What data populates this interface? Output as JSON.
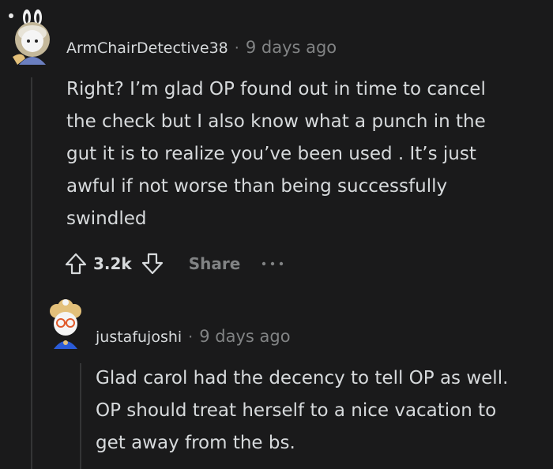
{
  "comments": [
    {
      "username": "ArmChairDetective38",
      "separator": "·",
      "timestamp": "9 days ago",
      "body_lines": [
        "Right? I’m glad OP found out in time to cancel",
        "the check but I also know what a punch in the",
        "gut it is to realize you’ve been used . It’s just",
        "awful if not worse than being successfully",
        "swindled"
      ],
      "actions": {
        "score": "3.2k",
        "share_label": "Share"
      }
    },
    {
      "username": "justafujoshi",
      "separator": "·",
      "timestamp": "9 days ago",
      "body_lines": [
        "Glad carol had the decency to tell OP as well.",
        "OP should treat herself to a nice vacation to",
        "get away from the bs."
      ]
    }
  ],
  "colors": {
    "background": "#1a1a1b",
    "text_primary": "#d7dadc",
    "text_secondary": "#818384",
    "thread_line": "#343536"
  },
  "icons": [
    "upvote-icon",
    "downvote-icon",
    "more-options-icon"
  ]
}
